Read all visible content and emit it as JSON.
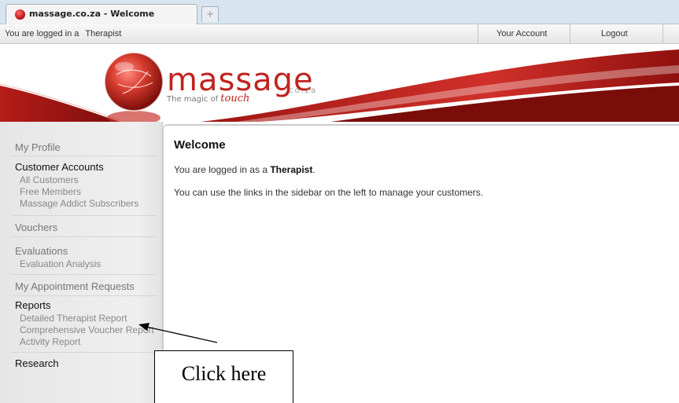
{
  "browser": {
    "tab_title": "massage.co.za - Welcome",
    "new_tab_glyph": "+",
    "favicon_icon": "red-sphere-icon"
  },
  "topbar": {
    "status_prefix": "You are logged in a",
    "status_role": "Therapist",
    "account_link": "Your Account",
    "logout_link": "Logout"
  },
  "banner": {
    "logo_text": "massage",
    "logo_tld": ".co.za",
    "tagline_prefix": "The magic of",
    "tagline_script": "touch",
    "brand_red": "#c0231f"
  },
  "sidebar": {
    "my_profile": "My Profile",
    "customer_accounts": "Customer Accounts",
    "customer_items": [
      "All Customers",
      "Free Members",
      "Massage Addict Subscribers"
    ],
    "vouchers": "Vouchers",
    "evaluations": "Evaluations",
    "evaluation_items": [
      "Evaluation Analysis"
    ],
    "appointment_requests": "My Appointment Requests",
    "reports": "Reports",
    "report_items": [
      "Detailed Therapist Report",
      "Comprehensive Voucher Report",
      "Activity Report"
    ],
    "research": "Research"
  },
  "content": {
    "heading": "Welcome",
    "line1_prefix": "You are logged in as a",
    "line1_role": "Therapist",
    "line1_suffix": ".",
    "line2": "You can use the links in the sidebar on the left to manage your customers."
  },
  "annotation": {
    "callout_text": "Click here"
  }
}
